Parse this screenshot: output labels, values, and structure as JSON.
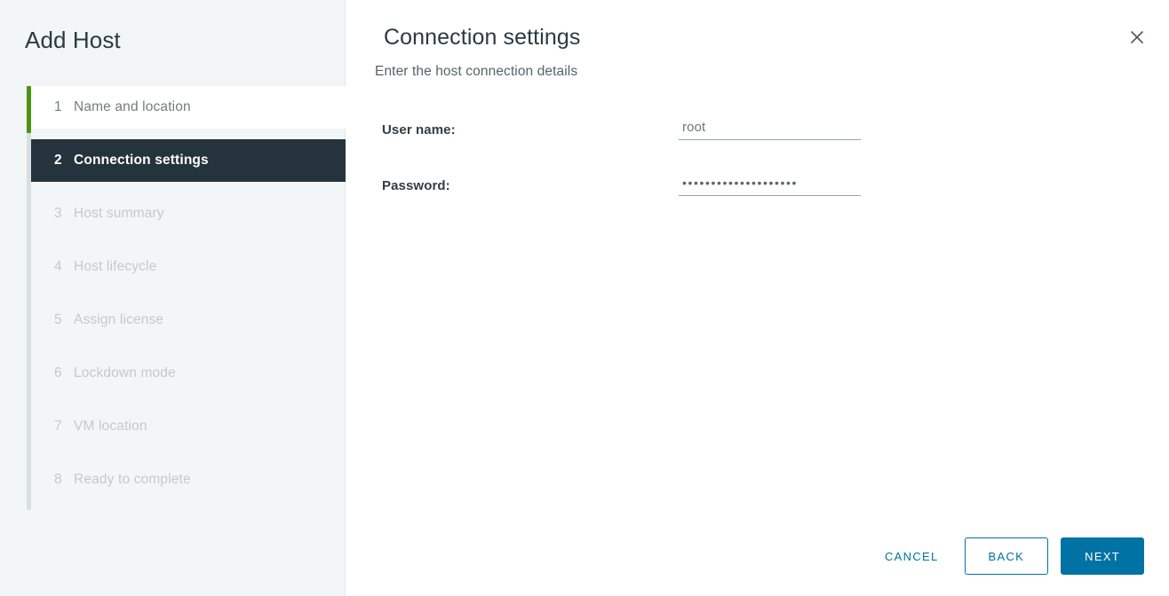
{
  "sidebar": {
    "title": "Add Host",
    "steps": [
      {
        "num": "1",
        "label": "Name and location",
        "state": "done"
      },
      {
        "num": "2",
        "label": "Connection settings",
        "state": "active"
      },
      {
        "num": "3",
        "label": "Host summary",
        "state": "upcoming"
      },
      {
        "num": "4",
        "label": "Host lifecycle",
        "state": "upcoming"
      },
      {
        "num": "5",
        "label": "Assign license",
        "state": "upcoming"
      },
      {
        "num": "6",
        "label": "Lockdown mode",
        "state": "upcoming"
      },
      {
        "num": "7",
        "label": "VM location",
        "state": "upcoming"
      },
      {
        "num": "8",
        "label": "Ready to complete",
        "state": "upcoming"
      }
    ]
  },
  "main": {
    "title": "Connection settings",
    "subtitle": "Enter the host connection details",
    "close_icon": "close-icon",
    "fields": [
      {
        "label": "User name:",
        "value": "root",
        "placeholder": "",
        "type": "text",
        "name": "username"
      },
      {
        "label": "Password:",
        "value": "••••••••••••••••••••",
        "placeholder": "",
        "type": "password",
        "name": "password"
      }
    ]
  },
  "footer": {
    "cancel_label": "CANCEL",
    "back_label": "BACK",
    "next_label": "NEXT"
  },
  "colors": {
    "accent_blue": "#0072a3",
    "progress_green": "#48960c",
    "active_step_bg": "#25333d",
    "sidebar_bg": "#f3f6f7"
  }
}
